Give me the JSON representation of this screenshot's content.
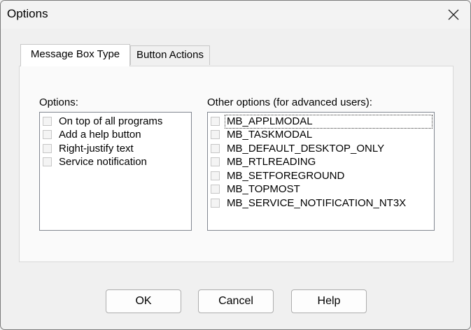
{
  "window": {
    "title": "Options"
  },
  "icons": {
    "close": "close-icon"
  },
  "tabs": [
    {
      "label": "Message Box Type",
      "active": true
    },
    {
      "label": "Button Actions",
      "active": false
    }
  ],
  "options_group": {
    "label": "Options:",
    "items": [
      {
        "label": "On top of all programs",
        "checked": false
      },
      {
        "label": "Add a help button",
        "checked": false
      },
      {
        "label": "Right-justify text",
        "checked": false
      },
      {
        "label": "Service notification",
        "checked": false
      }
    ]
  },
  "other_group": {
    "label": "Other options (for advanced users):",
    "items": [
      {
        "label": "MB_APPLMODAL",
        "checked": false,
        "focused": true
      },
      {
        "label": "MB_TASKMODAL",
        "checked": false
      },
      {
        "label": "MB_DEFAULT_DESKTOP_ONLY",
        "checked": false
      },
      {
        "label": "MB_RTLREADING",
        "checked": false
      },
      {
        "label": "MB_SETFOREGROUND",
        "checked": false
      },
      {
        "label": "MB_TOPMOST",
        "checked": false
      },
      {
        "label": "MB_SERVICE_NOTIFICATION_NT3X",
        "checked": false
      }
    ]
  },
  "buttons": {
    "ok": "OK",
    "cancel": "Cancel",
    "help": "Help"
  }
}
